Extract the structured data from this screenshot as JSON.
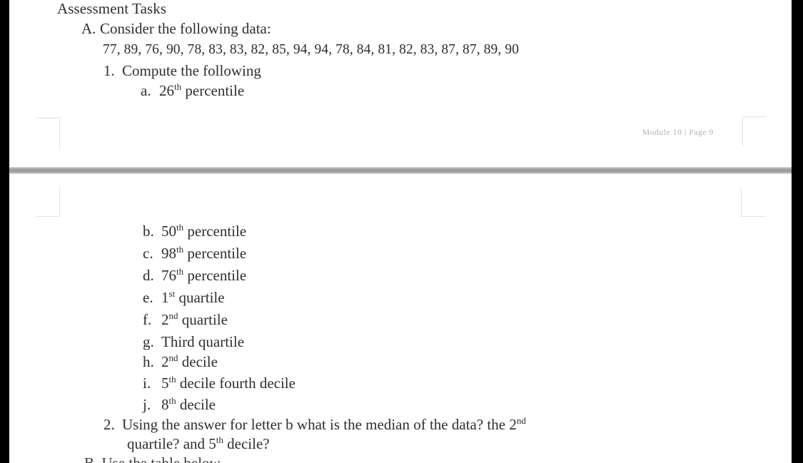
{
  "document": {
    "heading": "Assessment Tasks",
    "section_a": {
      "marker": "A.",
      "text": "Consider the following data:",
      "data_values": "77, 89, 76, 90, 78, 83, 83, 82, 85, 94, 94, 78, 84, 81, 82, 83, 87, 87, 89, 90",
      "question_1": {
        "marker": "1.",
        "text": "Compute the following",
        "items": [
          {
            "marker": "a.",
            "number": "26",
            "ordinal": "th",
            "text": "percentile"
          },
          {
            "marker": "b.",
            "number": "50",
            "ordinal": "th",
            "text": "percentile"
          },
          {
            "marker": "c.",
            "number": "98",
            "ordinal": "th",
            "text": "percentile"
          },
          {
            "marker": "d.",
            "number": "76",
            "ordinal": "th",
            "text": "percentile"
          },
          {
            "marker": "e.",
            "number": "1",
            "ordinal": "st",
            "text": "quartile"
          },
          {
            "marker": "f.",
            "number": "2",
            "ordinal": "nd",
            "text": "quartile"
          },
          {
            "marker": "g.",
            "number": "",
            "ordinal": "",
            "text": "Third quartile"
          },
          {
            "marker": "h.",
            "number": "2",
            "ordinal": "nd",
            "text": "decile"
          },
          {
            "marker": "i.",
            "number": "5",
            "ordinal": "th",
            "text": "decile fourth decile"
          },
          {
            "marker": "j.",
            "number": "8",
            "ordinal": "th",
            "text": "decile"
          }
        ]
      },
      "question_2": {
        "marker": "2.",
        "line1_part1": "Using the answer for letter b what is the median of the data? the 2",
        "line1_sup": "nd",
        "line2_part1": "quartile? and 5",
        "line2_sup": "th",
        "line2_part2": "decile?"
      }
    },
    "clipped_next_line": "B. Use the table below",
    "footer": {
      "text": "Module 10 | Page 9"
    }
  },
  "colors": {
    "paper": "#ffffff",
    "text": "#2e2e2e",
    "page_gap_bar": "#9a9a9a",
    "margin_mark": "#e2e2e2",
    "footer_text": "#b3b3b3",
    "letterbox": "#000000"
  }
}
